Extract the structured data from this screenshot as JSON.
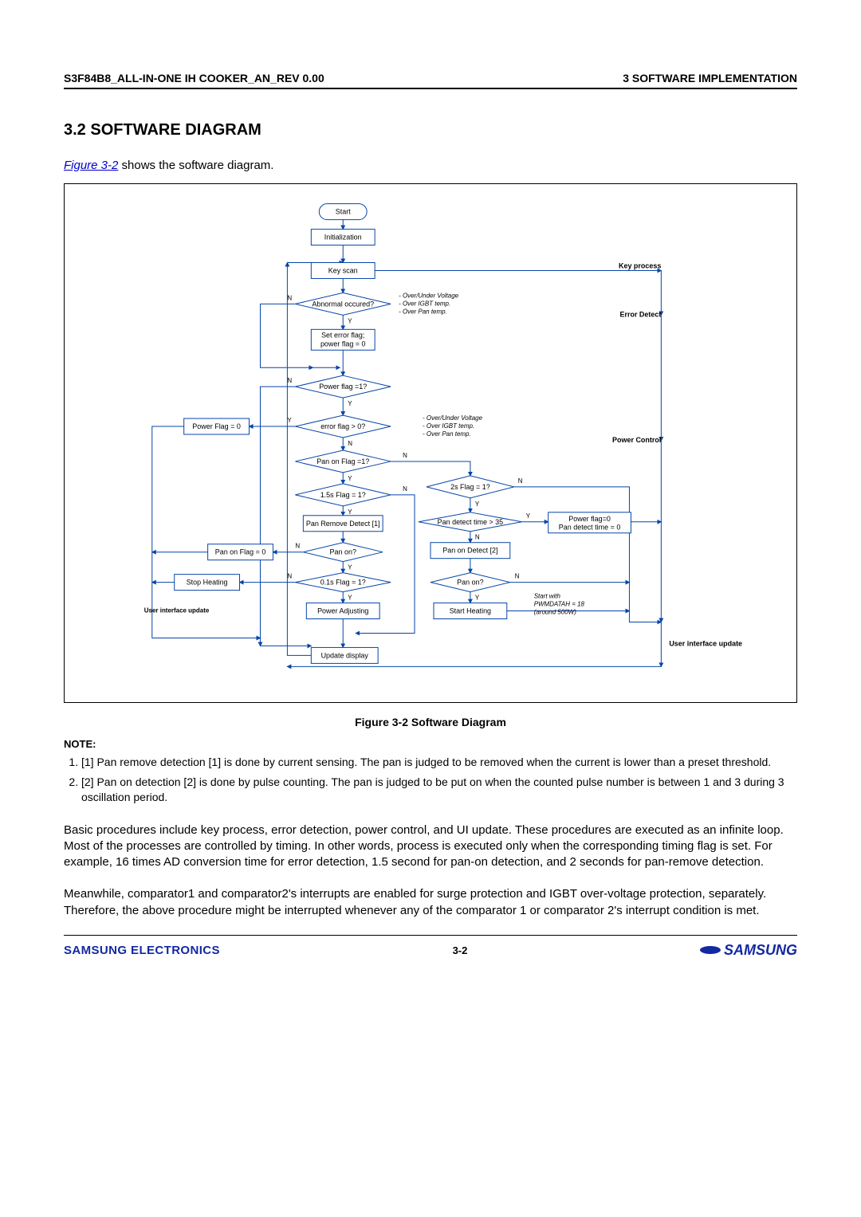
{
  "header": {
    "left": "S3F84B8_ALL-IN-ONE IH COOKER_AN_REV 0.00",
    "right": "3 SOFTWARE IMPLEMENTATION"
  },
  "section_title": "3.2 SOFTWARE DIAGRAM",
  "intro": {
    "link": "Figure 3-2",
    "rest": " shows the software diagram."
  },
  "figure": {
    "caption": "Figure 3-2     Software Diagram",
    "nodes": {
      "start": "Start",
      "init": "Initialization",
      "keyscan": "Key scan",
      "abnormal": "Abnormal occured?",
      "set_error1": "Set error flag;",
      "set_error2": "power flag = 0",
      "power_flag1": "Power flag =1?",
      "power_flag0": "Power Flag = 0",
      "error_flag": "error flag > 0?",
      "pan_on_flag1": "Pan on Flag =1?",
      "flag_1_5s": "1.5s Flag = 1?",
      "flag_2s": "2s Flag = 1?",
      "pan_remove": "Pan Remove Detect [1]",
      "pan_detect35": "Pan detect time > 35",
      "pf0_pdt0_a": "Power flag=0",
      "pf0_pdt0_b": "Pan detect time = 0",
      "pan_on_flag0": "Pan on Flag = 0",
      "pan_on_q1": "Pan on?",
      "pan_on_detect2": "Pan on Detect [2]",
      "stop_heating": "Stop Heating",
      "flag_0_1s": "0.1s Flag = 1?",
      "pan_on_q2": "Pan on?",
      "power_adj": "Power Adjusting",
      "start_heating": "Start Heating",
      "update_display": "Update display",
      "ui_update_left": "User interface update",
      "ui_update_right": "User interface update",
      "side_key": "Key process",
      "side_err": "Error Detect",
      "side_pc": "Power Control"
    },
    "annotations": {
      "a1_1": "- Over/Under Voltage",
      "a1_2": "- Over IGBT temp.",
      "a1_3": "- Over Pan temp.",
      "a2_1": "- Over/Under Voltage",
      "a2_2": "- Over IGBT temp.",
      "a2_3": "- Over Pan temp.",
      "a3_1": "Start with",
      "a3_2": "PWMDATAH = 18",
      "a3_3": "(around 500W)"
    },
    "yn": {
      "Y": "Y",
      "N": "N"
    }
  },
  "note_heading": "NOTE:",
  "notes": [
    "[1] Pan remove detection [1] is done by current sensing. The pan is judged to be removed when the current is lower than a preset threshold.",
    "[2] Pan on detection [2] is done by pulse counting. The pan is judged to be put on when the counted pulse number is between 1 and 3 during 3 oscillation period."
  ],
  "paragraphs": [
    "Basic procedures include key process, error detection, power control, and UI update. These procedures are executed as an infinite loop. Most of the processes are controlled by timing. In other words, process is executed only when the corresponding timing flag is set. For example, 16 times AD conversion time for error detection, 1.5 second for pan-on detection, and 2 seconds for pan-remove detection.",
    "Meanwhile, comparator1 and comparator2's interrupts are enabled for surge protection and IGBT over-voltage protection, separately. Therefore, the above procedure might be interrupted whenever any of the comparator 1 or comparator 2's interrupt condition is met."
  ],
  "footer": {
    "left": "SAMSUNG ELECTRONICS",
    "center": "3-2",
    "right": "SAMSUNG"
  }
}
